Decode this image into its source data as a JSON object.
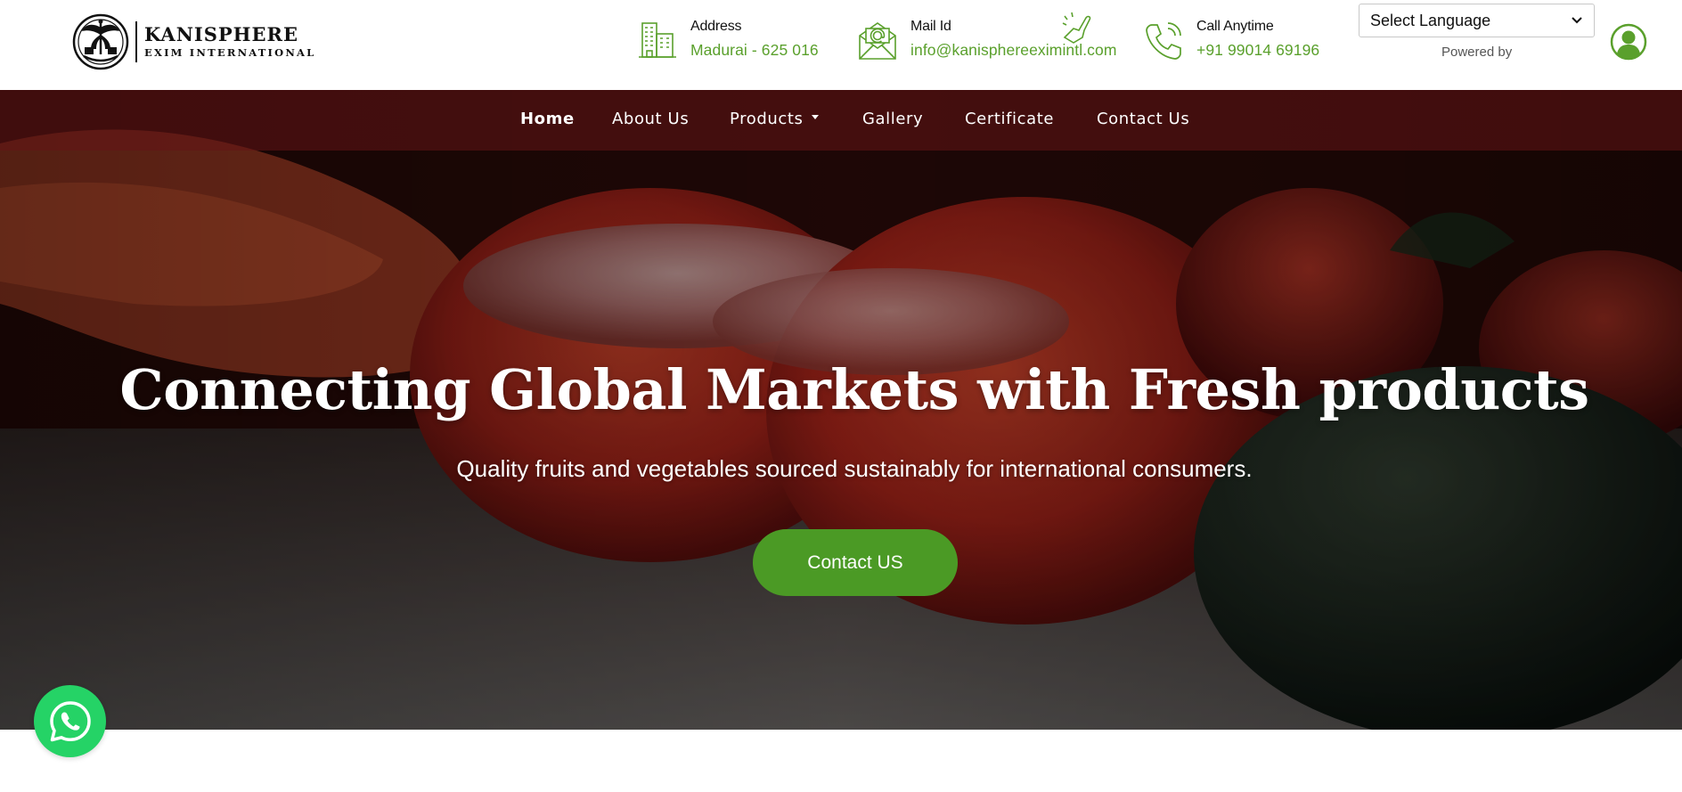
{
  "brand": {
    "name": "KANISPHERE",
    "subtitle": "EXIM INTERNATIONAL"
  },
  "contact_info": {
    "address": {
      "label": "Address",
      "value": "Madurai - 625 016",
      "icon": "building-icon"
    },
    "mail": {
      "label": "Mail Id",
      "value": "info@kanisphereeximintl.com",
      "icon": "envelope-icon"
    },
    "call": {
      "label": "Call Anytime",
      "value": "+91 99014 69196",
      "icon": "phone-icon"
    }
  },
  "language": {
    "selected": "Select Language",
    "powered_by": "Powered by"
  },
  "nav": {
    "items": [
      {
        "label": "Home",
        "active": true
      },
      {
        "label": "About Us",
        "active": false
      },
      {
        "label": "Products",
        "active": false,
        "dropdown": true
      },
      {
        "label": "Gallery",
        "active": false
      },
      {
        "label": "Certificate",
        "active": false
      },
      {
        "label": "Contact Us",
        "active": false
      }
    ]
  },
  "hero": {
    "title": "Connecting Global Markets with Fresh products",
    "subtitle": "Quality fruits and vegetables sourced sustainably for international consumers.",
    "cta_label": "Contact US"
  },
  "colors": {
    "accent_green": "#5aa02c",
    "button_green": "#4b9a25",
    "whatsapp_green": "#25d366",
    "nav_overlay": "#641416"
  }
}
